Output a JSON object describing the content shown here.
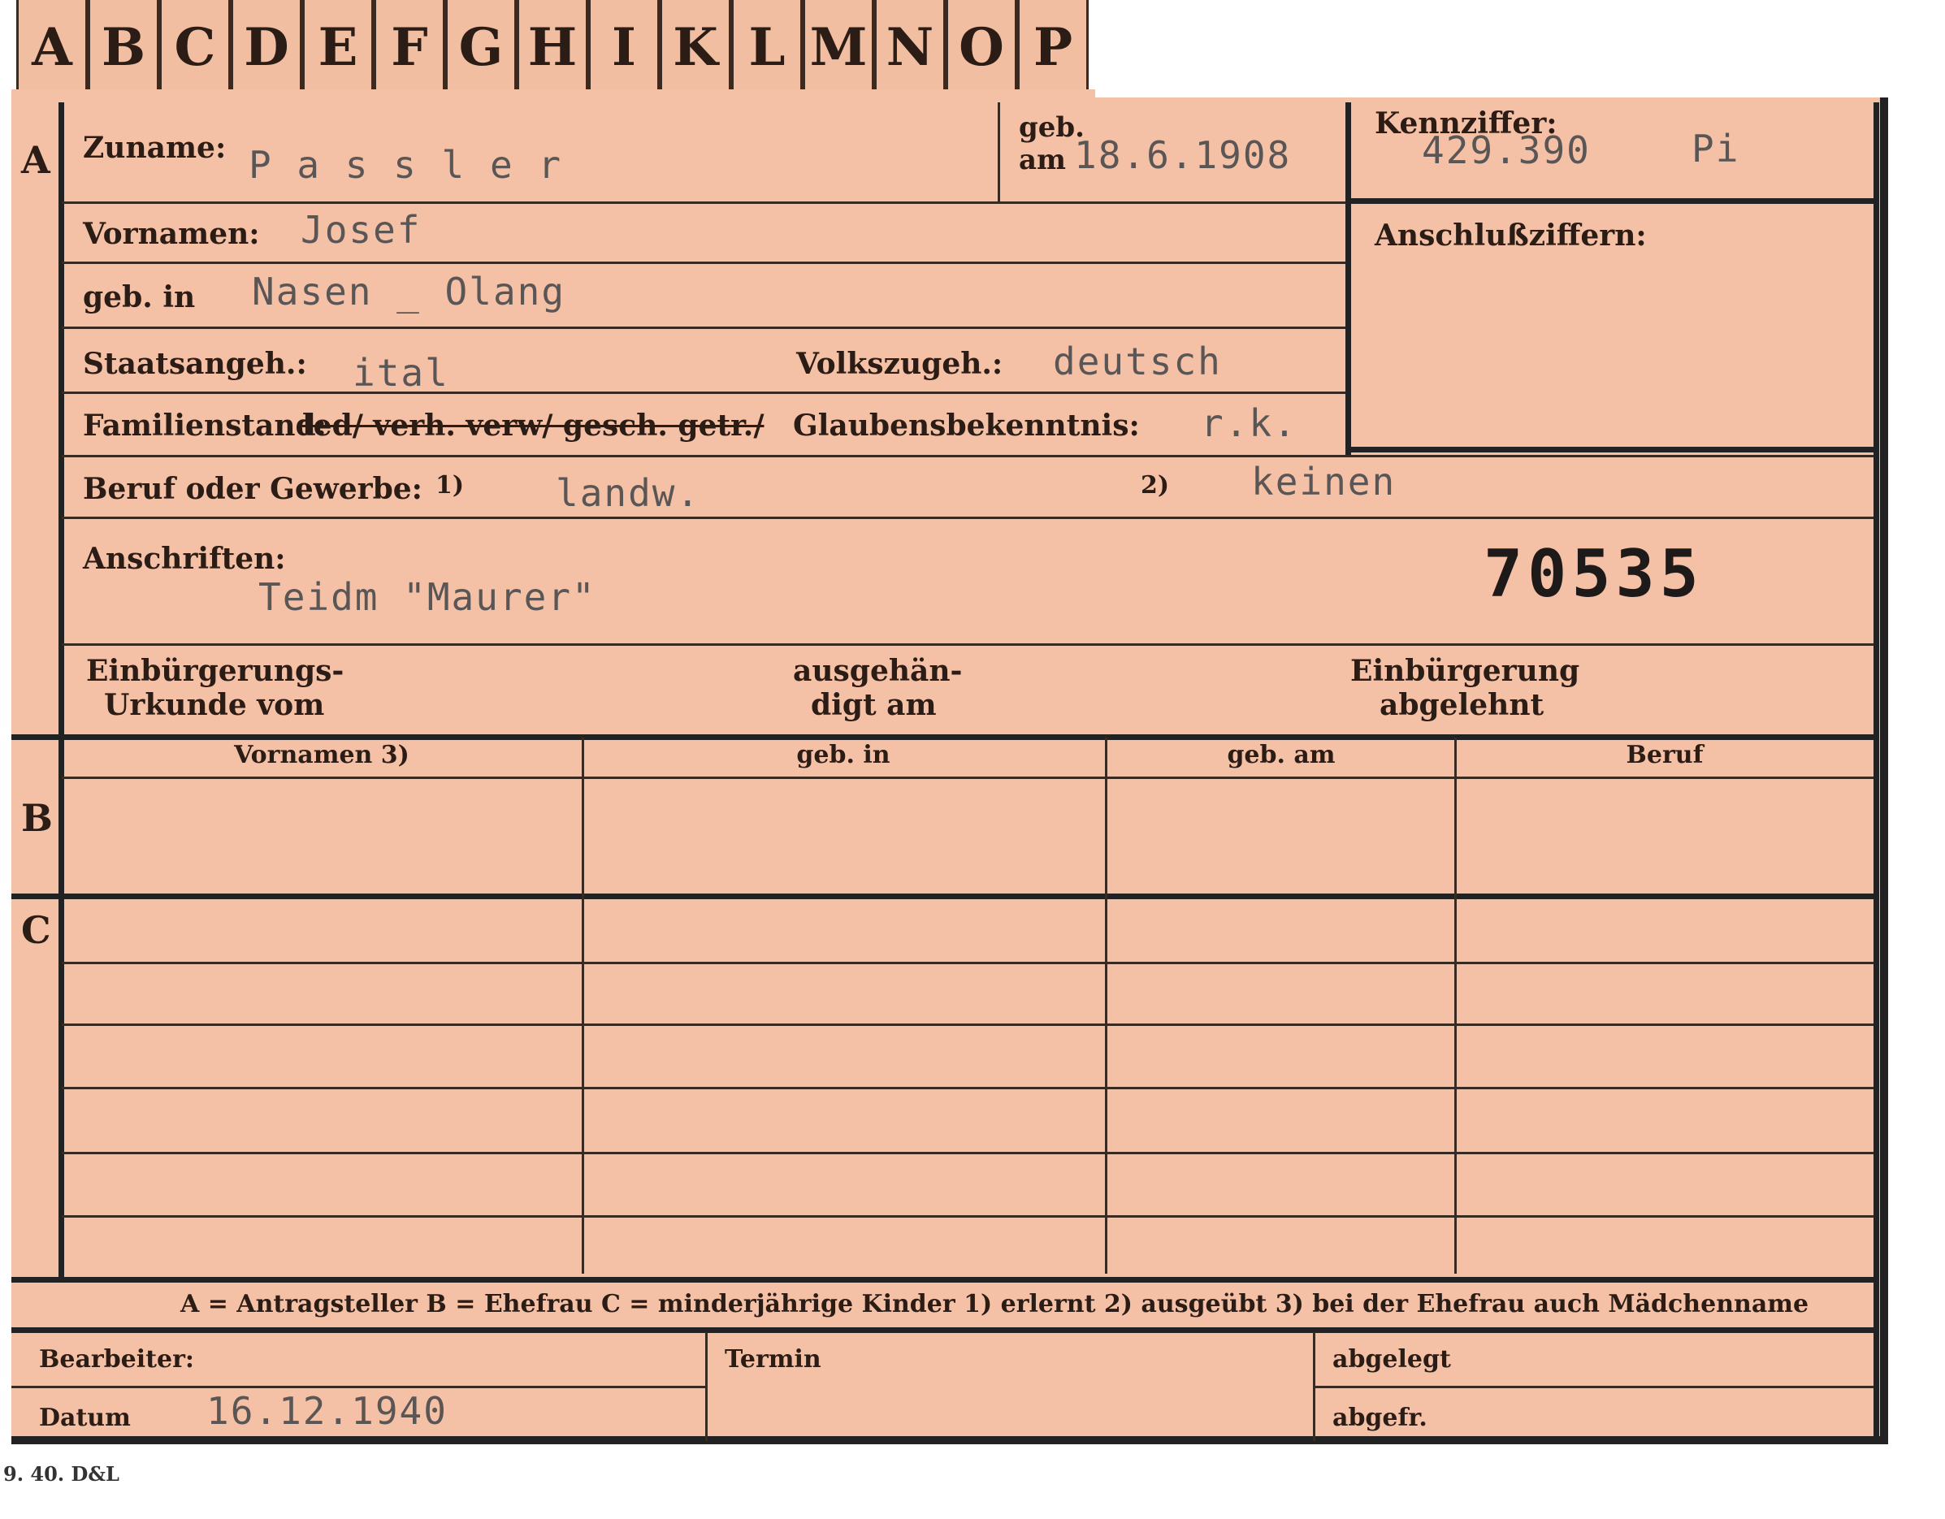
{
  "tabs": [
    "A",
    "B",
    "C",
    "D",
    "E",
    "F",
    "G",
    "H",
    "I",
    "K",
    "L",
    "M",
    "N",
    "O",
    "P"
  ],
  "sections": {
    "a": "A",
    "b": "B",
    "c": "C"
  },
  "labels": {
    "zuname": "Zuname:",
    "geb_am_1": "geb.",
    "geb_am_2": "am",
    "kennziffer": "Kennziffer:",
    "vornamen": "Vornamen:",
    "anschlussziffern": "Anschlußziffern:",
    "geb_in": "geb. in",
    "staatsangeh": "Staatsangeh.:",
    "volkszugeh": "Volkszugeh.:",
    "familienstand": "Familienstand:",
    "familienstand_options": "led/ verh. verw/ gesch. getr./",
    "glaubensbekenntnis": "Glaubensbekenntnis:",
    "beruf": "Beruf oder Gewerbe:",
    "fn1": "1)",
    "fn2": "2)",
    "anschriften": "Anschriften:",
    "einbuergerungs_urkunde_1": "Einbürgerungs-",
    "einbuergerungs_urkunde_2": "Urkunde vom",
    "ausgehaendigt_1": "ausgehän-",
    "ausgehaendigt_2": "digt am",
    "einbuergerung_abgelehnt_1": "Einbürgerung",
    "einbuergerung_abgelehnt_2": "abgelehnt",
    "col_vornamen": "Vornamen 3)",
    "col_geb_in": "geb. in",
    "col_geb_am": "geb. am",
    "col_beruf": "Beruf",
    "legend": "A = Antragsteller   B = Ehefrau   C = minderjährige Kinder   1) erlernt   2) ausgeübt   3) bei der Ehefrau auch Mädchenname",
    "bearbeiter": "Bearbeiter:",
    "termin": "Termin",
    "abgelegt": "abgelegt",
    "datum": "Datum",
    "abgefr": "abgefr.",
    "print_code": "9. 40. D&L"
  },
  "values": {
    "zuname": "P a s s l e r",
    "geb_am": "18.6.1908",
    "kennziffer": "429.390",
    "kennziffer_suffix": "Pi",
    "vornamen": "Josef",
    "geb_in": "Nasen _ Olang",
    "staatsangeh": "ital",
    "volkszugeh": "deutsch",
    "glaubensbekenntnis": "r.k.",
    "beruf_erlernt": "landw.",
    "beruf_ausgeuebt": "keinen",
    "anschrift": "Teidm \"Maurer\"",
    "stamp_number": "70535",
    "datum": "16.12.1940"
  }
}
